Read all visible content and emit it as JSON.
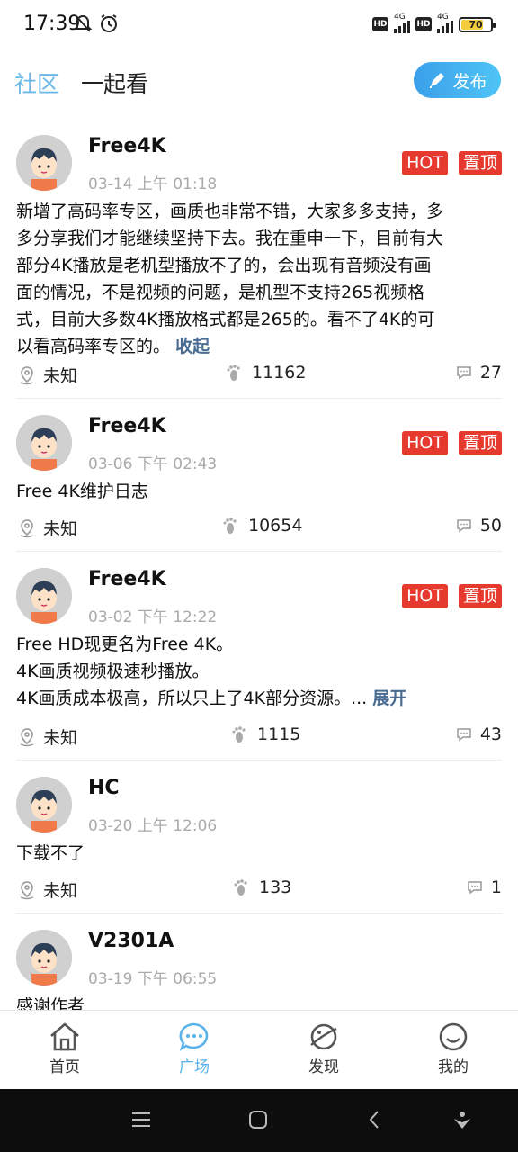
{
  "status_bar": {
    "time": "17:39",
    "hd_label": "HD",
    "network_label": "4G",
    "battery": "70",
    "battery_level": 0.7,
    "battery_color": "#f4cc3c"
  },
  "header": {
    "tab_active": "社区",
    "tab_inactive": "一起看",
    "publish_label": "发布",
    "accent_color": "#6bb8ea"
  },
  "posts": [
    {
      "username": "Free4K",
      "time": "03-14 上午 01:18",
      "tags": [
        "HOT",
        "置顶"
      ],
      "content": "新增了高码率专区，画质也非常不错，大家多多支持，多多分享我们才能继续坚持下去。我在重申一下，目前有大部分4K播放是老机型播放不了的，会出现有音频没有画面的情况，不是视频的问题，是机型不支持265视频格式，目前大多数4K播放格式都是265的。看不了4K的可以看高码率专区的。",
      "content_lines": [
        "新增了高码率专区，画质也非常不错，大家多多支持，多",
        "多分享我们才能继续坚持下去。我在重申一下，目前有大",
        "部分4K播放是老机型播放不了的，会出现有音频没有画",
        "面的情况，不是视频的问题，是机型不支持265视频格",
        "式，目前大多数4K播放格式都是265的。看不了4K的可",
        "以看高码率专区的。"
      ],
      "more": "收起",
      "location": "未知",
      "views": "11162",
      "comments": "27"
    },
    {
      "username": "Free4K",
      "time": "03-06 下午 02:43",
      "tags": [
        "HOT",
        "置顶"
      ],
      "content_lines": [
        "Free 4K维护日志"
      ],
      "location": "未知",
      "views": "10654",
      "comments": "50"
    },
    {
      "username": "Free4K",
      "time": "03-02 下午 12:22",
      "tags": [
        "HOT",
        "置顶"
      ],
      "content_lines": [
        "Free HD现更名为Free 4K。",
        "4K画质视频极速秒播放。",
        "4K画质成本极高，所以只上了4K部分资源。..."
      ],
      "more": "展开",
      "location": "未知",
      "views": "1115",
      "comments": "43"
    },
    {
      "username": "HC",
      "time": "03-20 上午 12:06",
      "tags": [],
      "content_lines": [
        "下载不了"
      ],
      "location": "未知",
      "views": "133",
      "comments": "1"
    },
    {
      "username": "V2301A",
      "time": "03-19 下午 06:55",
      "tags": [],
      "content_lines": [
        "感谢作者"
      ],
      "location": "",
      "views": "",
      "comments": ""
    }
  ],
  "bottom_nav": {
    "items": [
      {
        "label": "首页",
        "icon": "home-icon"
      },
      {
        "label": "广场",
        "icon": "chat-bubble-icon"
      },
      {
        "label": "发现",
        "icon": "planet-icon"
      },
      {
        "label": "我的",
        "icon": "smile-icon"
      }
    ],
    "active_index": 1
  },
  "colors": {
    "tag_red": "#e63a2e",
    "link_blue": "#4a6c93",
    "nav_active": "#5ab3ea"
  }
}
